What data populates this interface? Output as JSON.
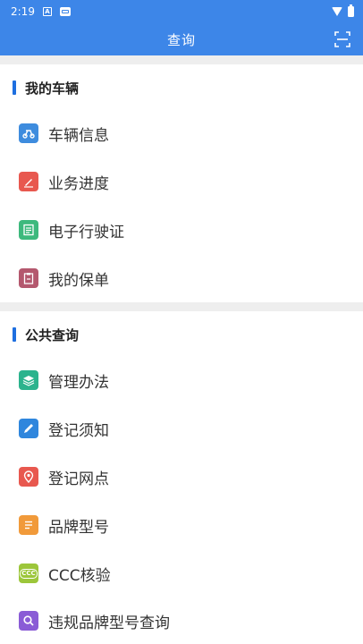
{
  "status_bar": {
    "time": "2:19"
  },
  "app_bar": {
    "title": "查询",
    "scan_icon": "scan-icon"
  },
  "sections": [
    {
      "title": "我的车辆",
      "items": [
        {
          "label": "车辆信息",
          "icon": "vehicle-icon",
          "color": "#3e8cde"
        },
        {
          "label": "业务进度",
          "icon": "edit-pen-icon",
          "color": "#e8584f"
        },
        {
          "label": "电子行驶证",
          "icon": "license-card-icon",
          "color": "#3db97d"
        },
        {
          "label": "我的保单",
          "icon": "clipboard-icon",
          "color": "#b4586e"
        }
      ]
    },
    {
      "title": "公共查询",
      "items": [
        {
          "label": "管理办法",
          "icon": "layers-icon",
          "color": "#2bb38d"
        },
        {
          "label": "登记须知",
          "icon": "pencil-icon",
          "color": "#2f86dd"
        },
        {
          "label": "登记网点",
          "icon": "location-pin-icon",
          "color": "#e8584f"
        },
        {
          "label": "品牌型号",
          "icon": "document-icon",
          "color": "#f19a3a"
        },
        {
          "label": "CCC核验",
          "icon": "ccc-icon",
          "color": "#9cc63a",
          "icon_text": "CCC"
        },
        {
          "label": "违规品牌型号查询",
          "icon": "search-icon",
          "color": "#8a5cd6"
        }
      ]
    }
  ]
}
